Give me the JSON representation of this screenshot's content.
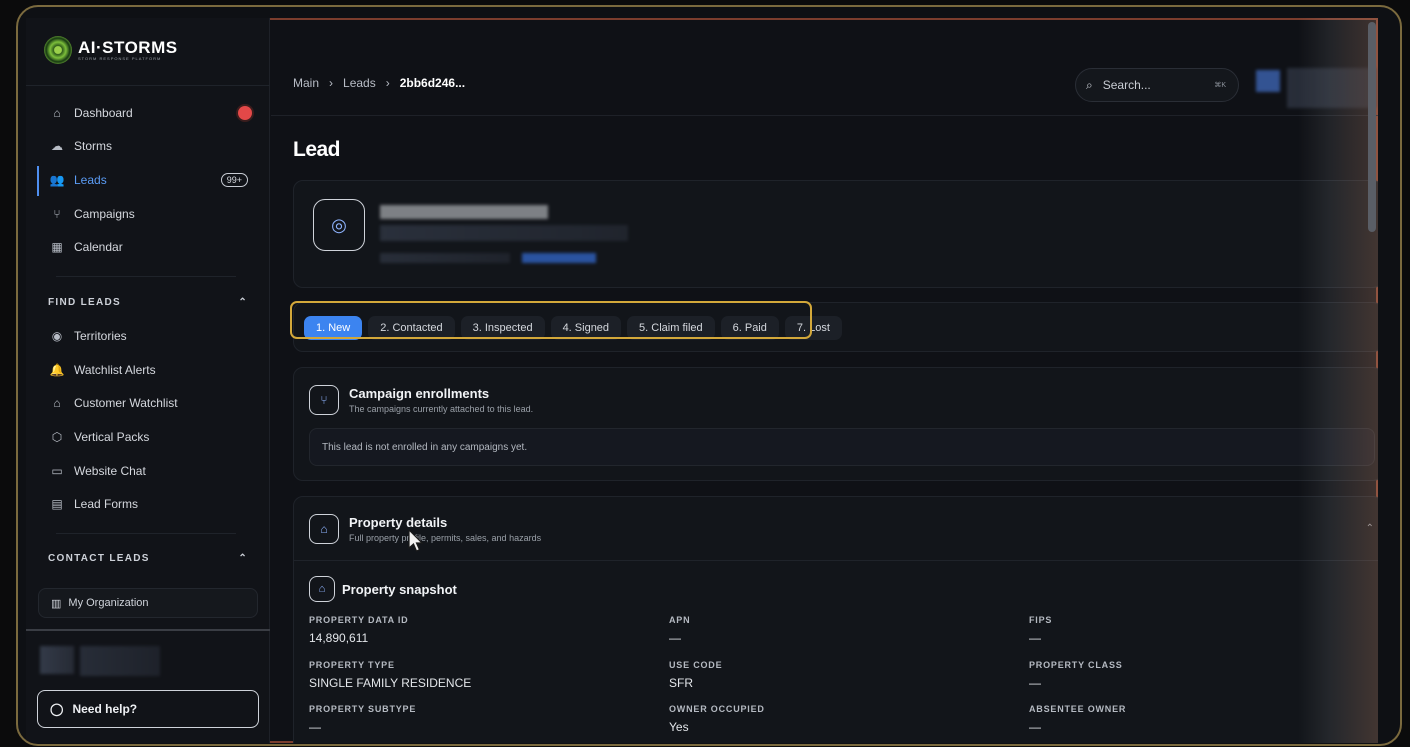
{
  "app": {
    "brand": "AI·STORMS",
    "brand_sub": "STORM RESPONSE PLATFORM"
  },
  "sidebar": {
    "nav": [
      {
        "label": "Dashboard",
        "icon": "home-icon"
      },
      {
        "label": "Storms",
        "icon": "cloud-icon"
      },
      {
        "label": "Leads",
        "icon": "users-icon",
        "badge": "99+",
        "active": true
      },
      {
        "label": "Campaigns",
        "icon": "branch-icon"
      },
      {
        "label": "Calendar",
        "icon": "calendar-icon"
      }
    ],
    "find_leads": {
      "title": "FIND LEADS",
      "items": [
        {
          "label": "Territories",
          "icon": "map-pin-icon"
        },
        {
          "label": "Watchlist Alerts",
          "icon": "bell-icon"
        },
        {
          "label": "Customer Watchlist",
          "icon": "home-icon"
        },
        {
          "label": "Vertical Packs",
          "icon": "package-icon"
        },
        {
          "label": "Website Chat",
          "icon": "chat-icon"
        },
        {
          "label": "Lead Forms",
          "icon": "clipboard-icon"
        }
      ]
    },
    "contact_leads": {
      "title": "CONTACT LEADS"
    },
    "org": "My Organization",
    "help": "Need help?"
  },
  "header": {
    "breadcrumb": [
      "Main",
      "Leads",
      "2bb6d246..."
    ],
    "search_placeholder": "Search...",
    "search_shortcut": "⌘K"
  },
  "page": {
    "title": "Lead"
  },
  "stages": [
    "1. New",
    "2. Contacted",
    "3. Inspected",
    "4. Signed",
    "5. Claim filed",
    "6. Paid",
    "7. Lost"
  ],
  "selected_stage": "1. New",
  "campaigns": {
    "title": "Campaign enrollments",
    "subtitle": "The campaigns currently attached to this lead.",
    "empty": "This lead is not enrolled in any campaigns yet."
  },
  "property": {
    "title": "Property details",
    "subtitle": "Full property profile, permits, sales, and hazards",
    "snapshot_title": "Property snapshot",
    "fields": [
      {
        "label": "PROPERTY DATA ID",
        "value": "14,890,611"
      },
      {
        "label": "APN",
        "value": "—"
      },
      {
        "label": "FIPS",
        "value": "—"
      },
      {
        "label": "PROPERTY TYPE",
        "value": "SINGLE FAMILY RESIDENCE"
      },
      {
        "label": "USE CODE",
        "value": "SFR"
      },
      {
        "label": "PROPERTY CLASS",
        "value": "—"
      },
      {
        "label": "PROPERTY SUBTYPE",
        "value": "—"
      },
      {
        "label": "OWNER OCCUPIED",
        "value": "Yes"
      },
      {
        "label": "ABSENTEE OWNER",
        "value": "—"
      }
    ]
  },
  "colors": {
    "accent": "#3c84f0",
    "highlight": "#d3a83a",
    "alert": "#e34848"
  }
}
